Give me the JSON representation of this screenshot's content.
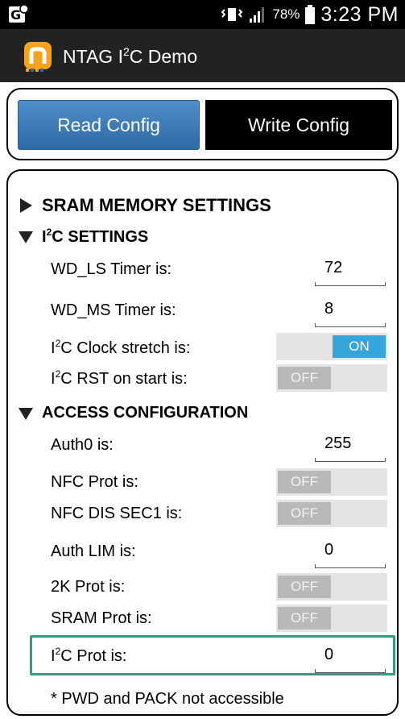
{
  "status_bar": {
    "battery": "78%",
    "time": "3:23 PM"
  },
  "app_bar": {
    "title_prefix": "NTAG I",
    "title_sup": "2",
    "title_suffix": "C Demo"
  },
  "buttons": {
    "read": "Read Config",
    "write": "Write Config"
  },
  "sections": {
    "sram": {
      "title": "SRAM MEMORY SETTINGS"
    },
    "i2c": {
      "title_prefix": "I",
      "title_sup": "2",
      "title_suffix": "C SETTINGS"
    },
    "access": {
      "title": "ACCESS CONFIGURATION"
    }
  },
  "i2c_settings": {
    "wd_ls_label": "WD_LS Timer is:",
    "wd_ls_value": "72",
    "wd_ms_label": "WD_MS Timer is:",
    "wd_ms_value": "8",
    "clock_stretch_label_prefix": "I",
    "clock_stretch_label_sup": "2",
    "clock_stretch_label_suffix": "C Clock stretch is:",
    "clock_stretch_state": "ON",
    "rst_label_prefix": "I",
    "rst_label_sup": "2",
    "rst_label_suffix": "C RST on start is:",
    "rst_state": "OFF"
  },
  "access_config": {
    "auth0_label": "Auth0 is:",
    "auth0_value": "255",
    "nfc_prot_label": "NFC Prot is:",
    "nfc_prot_state": "OFF",
    "nfc_dis_label": "NFC DIS SEC1 is:",
    "nfc_dis_state": "OFF",
    "auth_lim_label": "Auth LIM is:",
    "auth_lim_value": "0",
    "prot_2k_label": "2K Prot is:",
    "prot_2k_state": "OFF",
    "sram_prot_label": "SRAM Prot is:",
    "sram_prot_state": "OFF",
    "i2c_prot_label_prefix": "I",
    "i2c_prot_label_sup": "2",
    "i2c_prot_label_suffix": "C Prot is:",
    "i2c_prot_value": "0"
  },
  "footnote": "* PWD and PACK not accessible",
  "colors": {
    "accent": "#34a6dc",
    "highlight": "#2f9e85",
    "button_blue": "#3d7dbd",
    "app_bar": "#222222"
  }
}
